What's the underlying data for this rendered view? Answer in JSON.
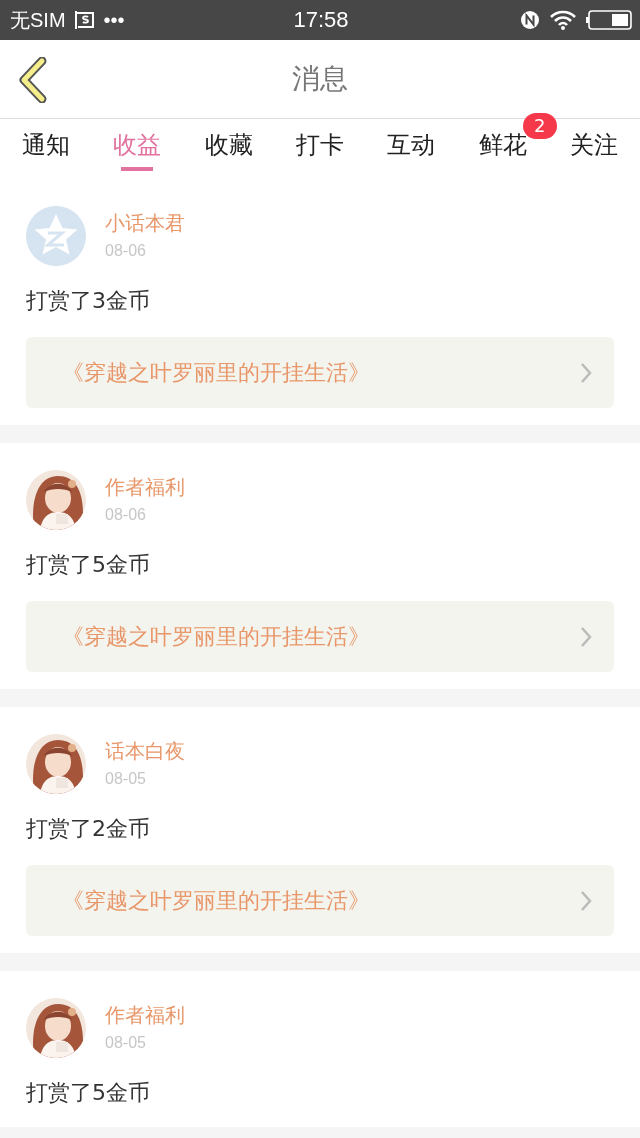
{
  "status_bar": {
    "carrier": "无SIM",
    "dots": "•••",
    "time": "17:58"
  },
  "header": {
    "title": "消息"
  },
  "tabs": [
    {
      "label": "通知",
      "selected": false
    },
    {
      "label": "收益",
      "selected": true
    },
    {
      "label": "收藏",
      "selected": false
    },
    {
      "label": "打卡",
      "selected": false
    },
    {
      "label": "互动",
      "selected": false
    },
    {
      "label": "鲜花",
      "selected": false,
      "badge": "2"
    },
    {
      "label": "关注",
      "selected": false
    }
  ],
  "messages": [
    {
      "avatar": {
        "kind": "logo"
      },
      "name": "小话本君",
      "date": "08-06",
      "text": "打赏了3金币",
      "book": "《穿越之叶罗丽里的开挂生活》"
    },
    {
      "name": "作者福利",
      "date": "08-06",
      "text": "打赏了5金币",
      "book": "《穿越之叶罗丽里的开挂生活》"
    },
    {
      "name": "话本白夜",
      "date": "08-05",
      "text": "打赏了2金币",
      "book": "《穿越之叶罗丽里的开挂生活》"
    },
    {
      "name": "作者福利",
      "date": "08-05",
      "text": "打赏了5金币"
    }
  ]
}
